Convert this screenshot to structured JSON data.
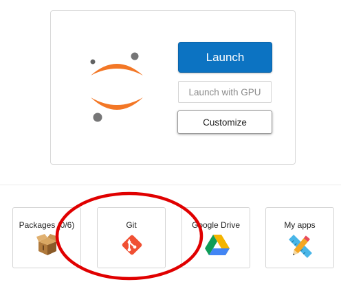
{
  "main": {
    "logo_icon": "jupyter-logo-icon",
    "launch_label": "Launch",
    "launch_gpu_label": "Launch with GPU",
    "customize_label": "Customize",
    "accent_color": "#0c73c2"
  },
  "apps": [
    {
      "label": "Packages (0/6)",
      "icon": "package-box-icon"
    },
    {
      "label": "Git",
      "icon": "git-icon"
    },
    {
      "label": "Google Drive",
      "icon": "google-drive-icon"
    },
    {
      "label": "My apps",
      "icon": "pencil-ruler-icon"
    }
  ],
  "annotation": {
    "shape": "red-ellipse",
    "color": "#e00000"
  }
}
